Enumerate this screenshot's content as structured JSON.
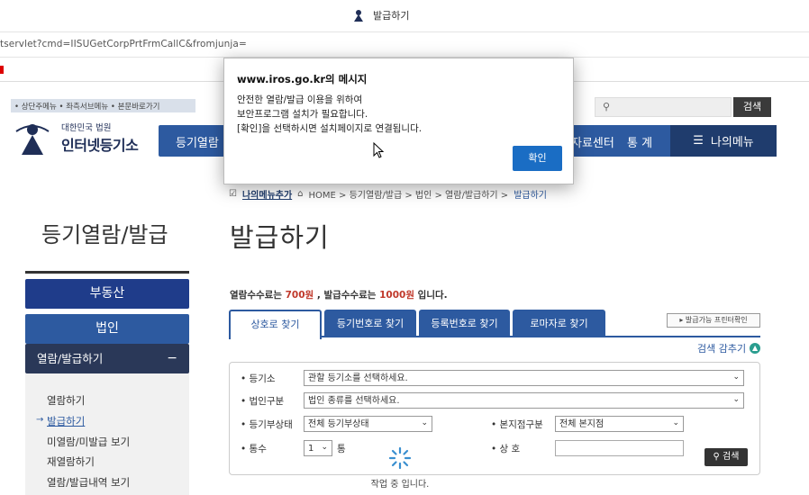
{
  "window": {
    "title": "발급하기"
  },
  "address": {
    "url": "tservlet?cmd=IISUGetCorpPrtFrmCallC&fromjunja="
  },
  "header": {
    "util_links": "• 상단주메뉴  • 좌측서브메뉴  • 본문바로가기",
    "brand_small": "대한민국 법원",
    "brand_big": "인터넷등기소",
    "search_button": "검색"
  },
  "gnb": {
    "items": [
      "등기열람",
      "자료센터",
      "통 계"
    ],
    "my_menu": "나의메뉴"
  },
  "breadcrumb": {
    "add": "나의메뉴추가",
    "path": "HOME > 등기열람/발급 > 법인 > 열람/발급하기 >",
    "current": "발급하기"
  },
  "sidebar": {
    "title": "등기열람/발급",
    "buttons": [
      "부동산",
      "법인"
    ],
    "section": "열람/발급하기",
    "section_toggle": "−",
    "items": [
      "열람하기",
      "발급하기",
      "미열람/미발급 보기",
      "재열람하기",
      "열람/발급내역 보기"
    ],
    "arrow": "→"
  },
  "main": {
    "title": "발급하기",
    "fee": {
      "p1": "열람수수료는 ",
      "v1": "700원",
      "p2": " , 발급수수료는 ",
      "v2": "1000원",
      "p3": " 입니다."
    },
    "tabs": [
      "상호로 찾기",
      "등기번호로 찾기",
      "등록번호로 찾기",
      "로마자로 찾기"
    ],
    "guide": "▸ 발급가능 프린터확인",
    "hide_search": "검색 감추기",
    "form": {
      "registry_label": "• 등기소",
      "registry_value": "관할 등기소를 선택하세요.",
      "corp_type_label": "• 법인구분",
      "corp_type_value": "법인 종류를 선택하세요.",
      "status_label": "• 등기부상태",
      "status_value": "전체 등기부상태",
      "branch_label": "• 본지점구분",
      "branch_value": "전체 본지점",
      "copies_label": "• 통수",
      "copies_value": "1",
      "copies_unit": "통",
      "name_label": "• 상 호",
      "search_button": "검색"
    },
    "loading_text": "작업 중 입니다."
  },
  "dialog": {
    "title": "www.iros.go.kr의 메시지",
    "line1": "안전한 열람/발급 이용을 위하여",
    "line2": "보안프로그램 설치가 필요합니다.",
    "line3": "[확인]을 선택하시면 설치페이지로 연결됩니다.",
    "ok": "확인"
  },
  "colors": {
    "primary": "#2d5aa0",
    "navy": "#1f3c8a",
    "dark": "#2a3858",
    "dialog_button": "#1a6dc4"
  }
}
